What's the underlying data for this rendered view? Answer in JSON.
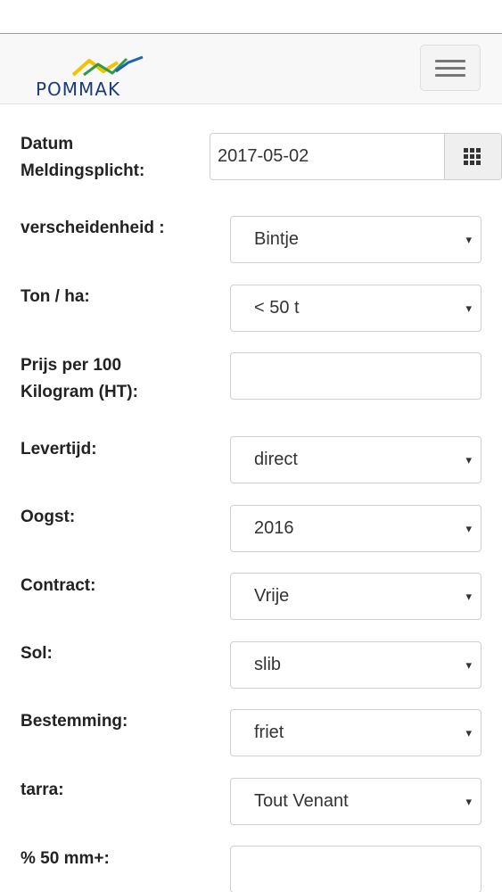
{
  "header": {
    "logo_text": "POMMAK",
    "menu_icon": "hamburger-menu-icon"
  },
  "form": {
    "datum": {
      "label": "Datum Meldingsplicht:",
      "value": "2017-05-02",
      "icon": "calendar-grid-icon"
    },
    "verscheidenheid": {
      "label": "verscheidenheid :",
      "value": "Bintje"
    },
    "ton": {
      "label": "Ton / ha:",
      "value": "< 50 t"
    },
    "prijs": {
      "label": "Prijs per 100 Kilogram (HT):",
      "value": ""
    },
    "levertijd": {
      "label": "Levertijd:",
      "value": "direct"
    },
    "oogst": {
      "label": "Oogst:",
      "value": "2016"
    },
    "contract": {
      "label": "Contract:",
      "value": "Vrije"
    },
    "sol": {
      "label": "Sol:",
      "value": "slib"
    },
    "bestemming": {
      "label": "Bestemming:",
      "value": "friet"
    },
    "tarra": {
      "label": "tarra:",
      "value": "Tout Venant"
    },
    "mm50": {
      "label": "% 50 mm+:",
      "value": ""
    },
    "caret": "▾"
  },
  "colors": {
    "logo_text": "#1b3a78",
    "logo_yellow": "#f2c300",
    "logo_green": "#2f9a4a",
    "logo_blue": "#1f63b0"
  }
}
